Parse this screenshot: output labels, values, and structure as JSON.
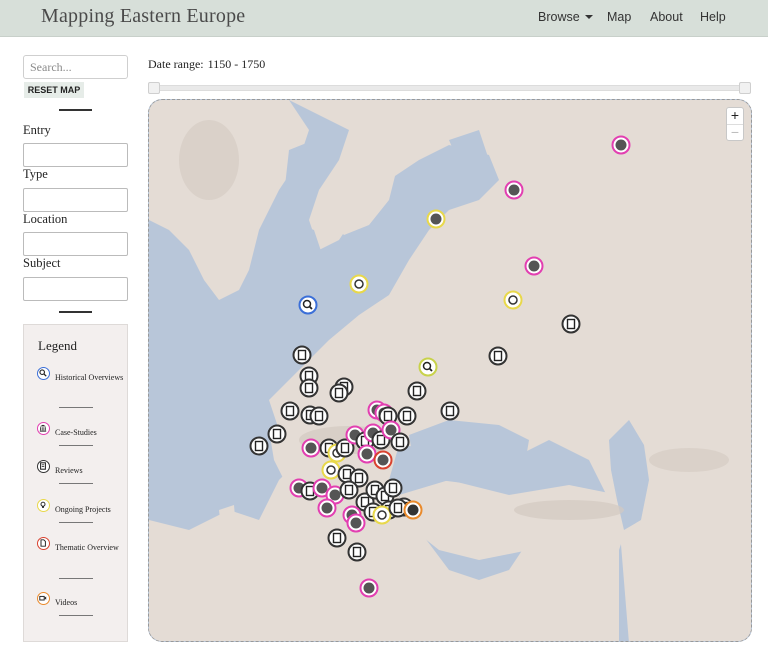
{
  "header": {
    "brand": "Mapping Eastern Europe",
    "nav": [
      {
        "label": "Browse",
        "dropdown": true
      },
      {
        "label": "Map"
      },
      {
        "label": "About"
      },
      {
        "label": "Help"
      }
    ]
  },
  "sidebar": {
    "search_placeholder": "Search...",
    "reset_label": "RESET MAP",
    "filters": [
      {
        "label": "Entry",
        "value": ""
      },
      {
        "label": "Type",
        "value": ""
      },
      {
        "label": "Location",
        "value": ""
      },
      {
        "label": "Subject",
        "value": ""
      }
    ]
  },
  "legend": {
    "title": "Legend",
    "items": [
      {
        "label": "Historical Overviews",
        "color": "#3b6fd8",
        "icon": "magnifier-icon"
      },
      {
        "label": "Case-Studies",
        "color": "#e23fb1",
        "icon": "building-icon"
      },
      {
        "label": "Reviews",
        "color": "#333333",
        "icon": "book-icon"
      },
      {
        "label": "Ongoing Projects",
        "color": "#e8d84a",
        "icon": "lightbulb-icon"
      },
      {
        "label": "Thematic Overview",
        "color": "#d9422f",
        "icon": "document-icon"
      },
      {
        "label": "Videos",
        "color": "#e98a2c",
        "icon": "video-icon"
      }
    ]
  },
  "date_range": {
    "label": "Date range:",
    "value": "1150 - 1750"
  },
  "map": {
    "zoom_in": "+",
    "zoom_out": "−"
  }
}
